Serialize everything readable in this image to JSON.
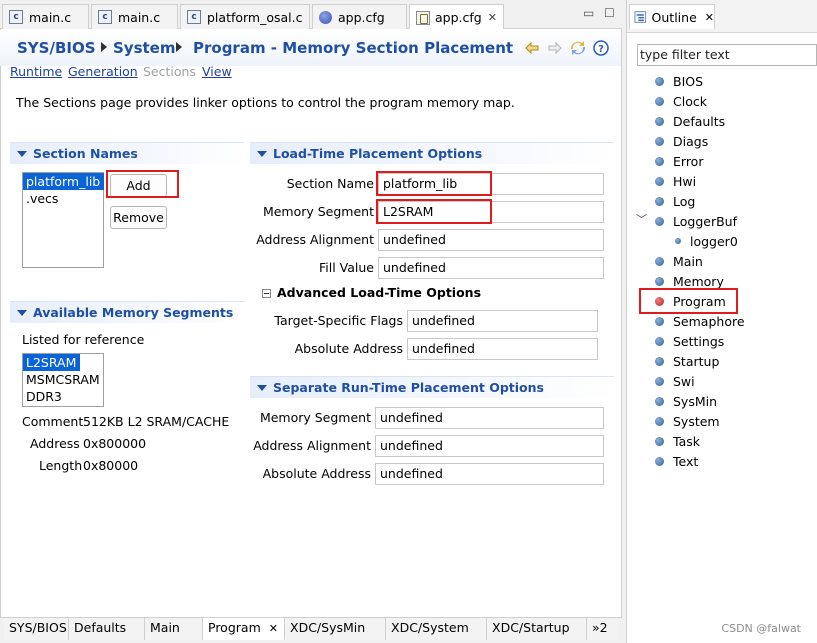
{
  "editor_tabs": [
    {
      "label": "main.c",
      "icon": "c-file-icon"
    },
    {
      "label": "main.c",
      "icon": "c-file-icon"
    },
    {
      "label": "platform_osal.c",
      "icon": "c-file-icon"
    },
    {
      "label": "app.cfg",
      "icon": "cfg-globe-icon"
    },
    {
      "label": "app.cfg",
      "icon": "cfg-file-icon",
      "active": true
    }
  ],
  "breadcrumb": {
    "root": "SYS/BIOS",
    "section": "System",
    "page": "Program - Memory Section Placement"
  },
  "links": {
    "runtime": "Runtime",
    "generation": "Generation",
    "sections": "Sections",
    "view": "View"
  },
  "description": "The Sections page provides linker options to control the program memory map.",
  "section_names": {
    "title": "Section Names",
    "items": [
      "platform_lib",
      ".vecs"
    ],
    "add_label": "Add",
    "remove_label": "Remove"
  },
  "available_memory": {
    "title": "Available Memory Segments",
    "caption": "Listed for reference",
    "items": [
      "L2SRAM",
      "MSMCSRAM",
      "DDR3"
    ],
    "comment_label": "Comment",
    "comment_value": "512KB L2 SRAM/CACHE",
    "address_label": "Address",
    "address_value": "0x800000",
    "length_label": "Length",
    "length_value": "0x80000"
  },
  "load_time": {
    "title": "Load-Time Placement Options",
    "section_name_label": "Section Name",
    "section_name_value": "platform_lib",
    "memory_segment_label": "Memory Segment",
    "memory_segment_value": "L2SRAM",
    "address_alignment_label": "Address Alignment",
    "address_alignment_value": "undefined",
    "fill_value_label": "Fill Value",
    "fill_value_value": "undefined"
  },
  "advanced": {
    "title": "Advanced Load-Time Options",
    "target_flags_label": "Target-Specific Flags",
    "target_flags_value": "undefined",
    "absolute_address_label": "Absolute Address",
    "absolute_address_value": "undefined"
  },
  "runtime_options": {
    "title": "Separate Run-Time Placement Options",
    "memory_segment_label": "Memory Segment",
    "memory_segment_value": "undefined",
    "address_alignment_label": "Address Alignment",
    "address_alignment_value": "undefined",
    "absolute_address_label": "Absolute Address",
    "absolute_address_value": "undefined"
  },
  "bottom_tabs": [
    "SYS/BIOS",
    "Defaults",
    "Main",
    "Program",
    "XDC/SysMin",
    "XDC/System",
    "XDC/Startup",
    "»2"
  ],
  "outline": {
    "title": "Outline",
    "filter_placeholder": "type filter text",
    "items": [
      "BIOS",
      "Clock",
      "Defaults",
      "Diags",
      "Error",
      "Hwi",
      "Log",
      "LoggerBuf",
      "logger0",
      "Main",
      "Memory",
      "Program",
      "Semaphore",
      "Settings",
      "Startup",
      "Swi",
      "SysMin",
      "System",
      "Task",
      "Text"
    ]
  },
  "watermark": "CSDN @falwat",
  "colors": {
    "accent": "#1f4fa3",
    "selection": "#0a64d8",
    "highlight_box": "#e01b1b"
  }
}
